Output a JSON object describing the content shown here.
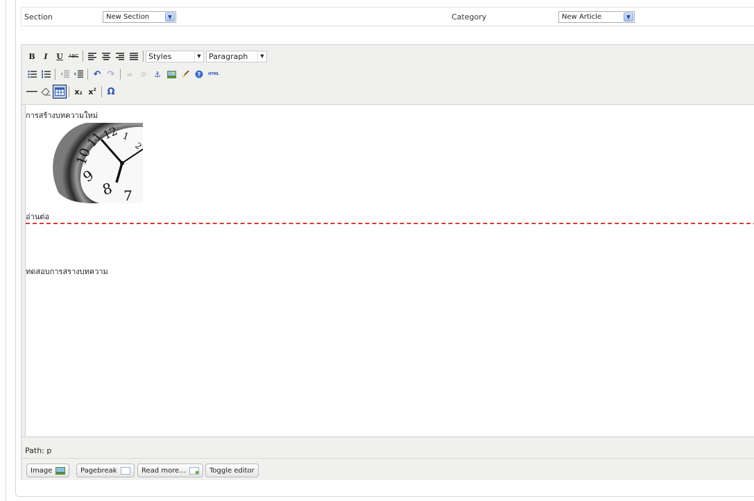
{
  "form": {
    "section_label": "Section",
    "section_value": "New Section",
    "category_label": "Category",
    "category_value": "New Article"
  },
  "toolbar": {
    "styles_value": "Styles",
    "format_value": "Paragraph",
    "bold": "B",
    "italic": "I",
    "underline": "U",
    "strike": "ABC",
    "html": "HTML",
    "subscript": "x",
    "superscript": "x",
    "omega": "Ω"
  },
  "content": {
    "line1": "การสร้างบทความใหม่",
    "readmore_text": "อ่านต่อ",
    "line2": "ทดสอบการสรางบทความ"
  },
  "statusbar": {
    "path": "Path: p"
  },
  "buttons": {
    "image": "Image",
    "pagebreak": "Pagebreak",
    "readmore": "Read more...",
    "toggle": "Toggle editor"
  },
  "colors": {
    "readmore_rule": "#d23b3b",
    "toolbar_bg": "#f0f0ee"
  }
}
